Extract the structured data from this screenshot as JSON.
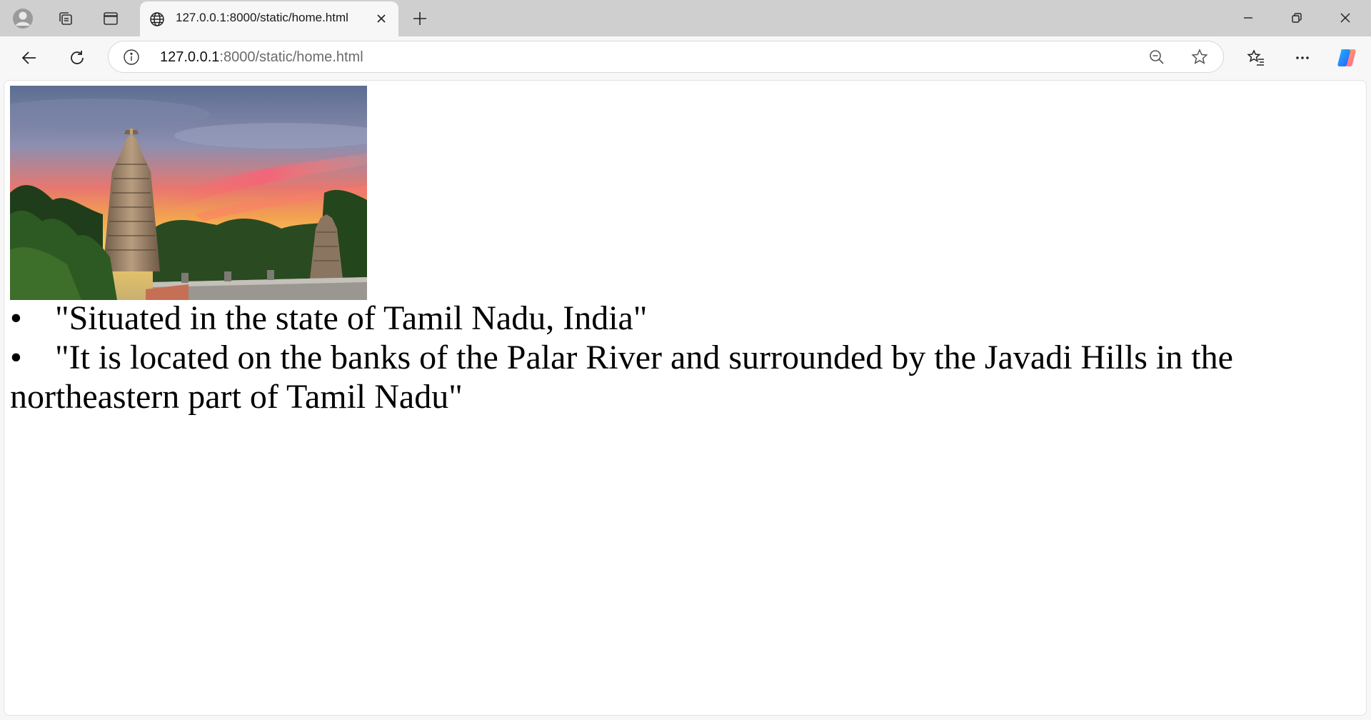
{
  "browser": {
    "tab": {
      "title": "127.0.0.1:8000/static/home.html"
    },
    "address": {
      "host": "127.0.0.1",
      "path": ":8000/static/home.html"
    }
  },
  "page": {
    "image_alt": "Temple gopuram at sunset surrounded by trees",
    "bullet_glyph": "•",
    "items": [
      "\"Situated in the state of Tamil Nadu, India\"",
      "\"It is located on the banks of the Palar River and surrounded by the Javadi Hills in the northeastern part of Tamil Nadu\""
    ]
  },
  "icons": {
    "profile": "profile-avatar-icon",
    "workspaces": "workspaces-icon",
    "vertical_tabs": "vertical-tabs-icon",
    "globe": "globe-icon",
    "close_tab": "close-icon",
    "new_tab": "plus-icon",
    "minimize": "minimize-icon",
    "restore": "restore-icon",
    "close_window": "close-window-icon",
    "back": "back-arrow-icon",
    "refresh": "refresh-icon",
    "site_info": "info-icon",
    "zoom": "zoom-out-icon",
    "favorite": "star-icon",
    "favorites": "favorites-icon",
    "more": "more-icon",
    "copilot": "copilot-icon"
  },
  "colors": {
    "chrome_bg": "#cfcfcf",
    "toolbar_bg": "#f7f7f7",
    "page_bg": "#ffffff",
    "text": "#000000",
    "url_muted": "#6b6b6b"
  }
}
